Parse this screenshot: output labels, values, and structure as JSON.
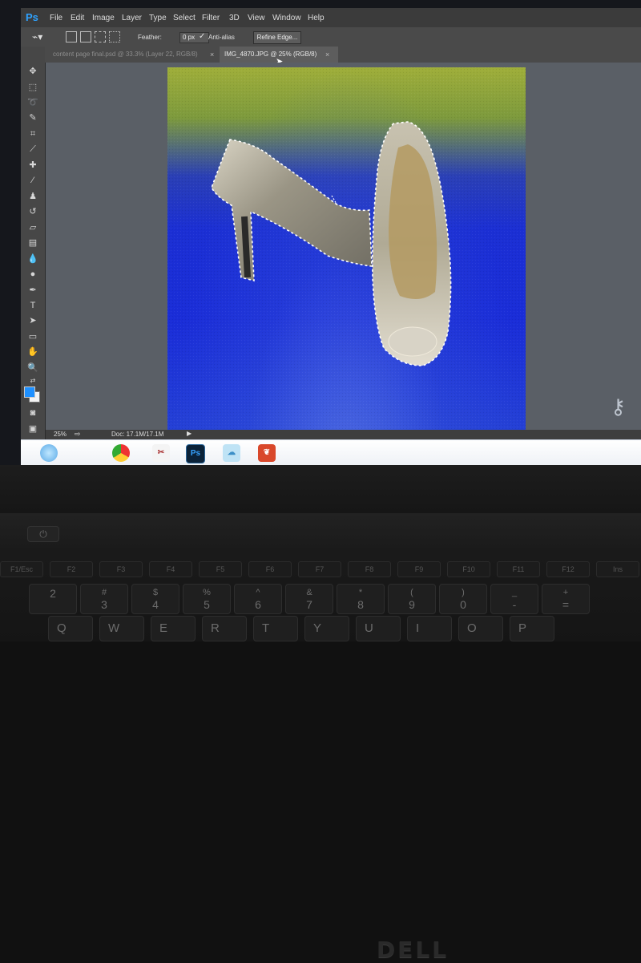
{
  "app": {
    "logo": "Ps",
    "menu": [
      "File",
      "Edit",
      "Image",
      "Layer",
      "Type",
      "Select",
      "Filter",
      "3D",
      "View",
      "Window",
      "Help"
    ]
  },
  "options": {
    "feather_label": "Feather:",
    "feather_value": "0 px",
    "antialias_label": "Anti-alias",
    "refine_edge": "Refine Edge..."
  },
  "tabs": [
    {
      "label": "content page final.psd @ 33.3% (Layer 22, RGB/8)",
      "active": false
    },
    {
      "label": "IMG_4870.JPG @ 25% (RGB/8)",
      "active": true
    }
  ],
  "tab_close": "×",
  "status": {
    "zoom": "25%",
    "doc_info": "Doc: 17.1M/17.1M"
  },
  "taskbar": {
    "icons": [
      "start-orb",
      "chrome",
      "snipping",
      "photoshop",
      "cloud",
      "acrobat"
    ],
    "ps_label": "Ps"
  },
  "colors": {
    "foreground": "#1e90ff",
    "background": "#f3f3f3",
    "ps_accent": "#2ea2ff"
  },
  "laptop": {
    "brand": "DELL",
    "power_glyph": "⏻"
  },
  "keyboard": {
    "fn_row": [
      "F1/Esc",
      "F2",
      "F3",
      "F4",
      "F5",
      "F6",
      "F7",
      "F8",
      "F9",
      "F10",
      "F11",
      "F12",
      "Ins"
    ],
    "number_row": [
      {
        "top": "",
        "bottom": "2"
      },
      {
        "top": "#",
        "bottom": "3"
      },
      {
        "top": "$",
        "bottom": "4"
      },
      {
        "top": "%",
        "bottom": "5"
      },
      {
        "top": "^",
        "bottom": "6"
      },
      {
        "top": "&",
        "bottom": "7"
      },
      {
        "top": "*",
        "bottom": "8"
      },
      {
        "top": "(",
        "bottom": "9"
      },
      {
        "top": ")",
        "bottom": "0"
      },
      {
        "top": "_",
        "bottom": "-"
      },
      {
        "top": "+",
        "bottom": "="
      }
    ],
    "letter_row": [
      "Q",
      "W",
      "E",
      "R",
      "T",
      "Y",
      "U",
      "I",
      "O",
      "P"
    ]
  }
}
